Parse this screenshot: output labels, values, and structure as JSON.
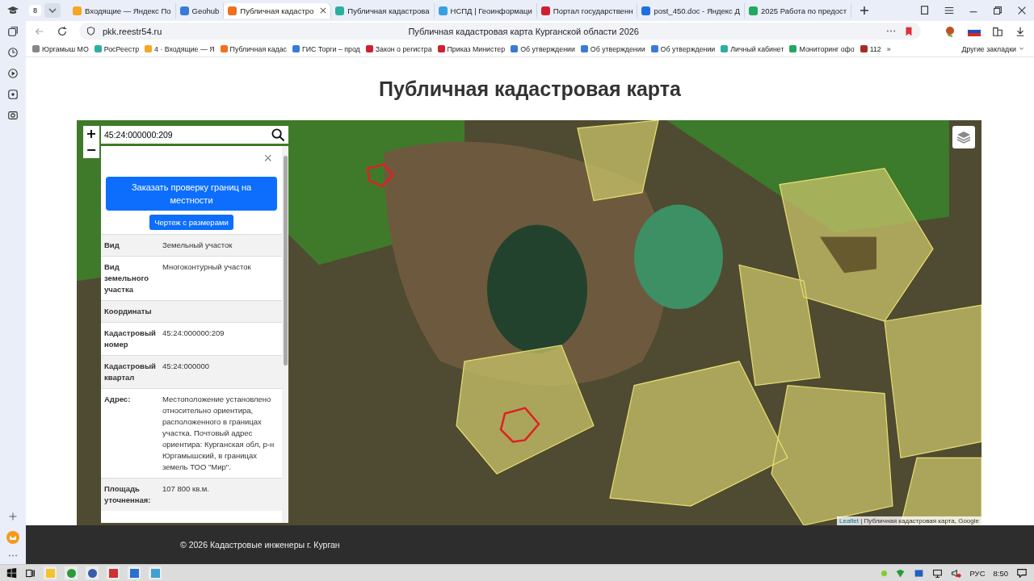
{
  "browser": {
    "tab_count": "8",
    "tabs": [
      {
        "title": "Входящие — Яндекс По",
        "selected": false
      },
      {
        "title": "Geohub",
        "selected": false
      },
      {
        "title": "Публичная кадастро",
        "selected": true
      },
      {
        "title": "Публичная кадастрова",
        "selected": false
      },
      {
        "title": "НСПД | Геоинформаци",
        "selected": false
      },
      {
        "title": "Портал государственн",
        "selected": false
      },
      {
        "title": "post_450.doc - Яндекс Д",
        "selected": false
      },
      {
        "title": "2025 Работа по предост",
        "selected": false
      }
    ],
    "url": "pkk.reestr54.ru",
    "page_title": "Публичная кадастровая карта Курганской области 2026",
    "bookmarks": [
      "Юргамыш МО",
      "РосРеестр",
      "4 · Входящие — Я",
      "Публичная кадас",
      "ГИС Торги – прод",
      "Закон о регистра",
      "Приказ Министер",
      "Об утверждении",
      "Об утверждении",
      "Об утверждении",
      "Личный кабинет",
      "Мониторинг офо",
      "112"
    ],
    "more": "»",
    "other_bookmarks": "Другие закладки"
  },
  "page": {
    "heading": "Публичная кадастровая карта",
    "zoom_in": "+",
    "zoom_out": "−",
    "search": {
      "value": "45:24:000000:209"
    },
    "panel": {
      "close": "×",
      "order_button": "Заказать проверку границ на местности",
      "drawing_button": "Чертеж с размерами",
      "rows": [
        {
          "label": "Вид",
          "value": "Земельный участок"
        },
        {
          "label": "Вид земельного участка",
          "value": "Многоконтурный участок"
        },
        {
          "label": "Координаты"
        },
        {
          "label": "Кадастровый номер",
          "value": "45:24:000000:209"
        },
        {
          "label": "Кадастровый квартал",
          "value": "45:24:000000"
        },
        {
          "label": "Адрес:",
          "value": "Местоположение установлено относительно ориентира, расположенного в границах участка. Почтовый адрес ориентира: Курганская обл, р-н Юргамышский, в границах земель ТОО \"Мир\"."
        },
        {
          "label": "Площадь уточненная:",
          "value": "107 800 кв.м."
        }
      ]
    },
    "attribution_link": "Leaflet",
    "attribution_text": "| Публичная кадастровая карта, Google",
    "footer": "© 2026 Кадастровые инженеры г. Курган"
  },
  "taskbar": {
    "language": "РУС",
    "time": "8:50"
  }
}
